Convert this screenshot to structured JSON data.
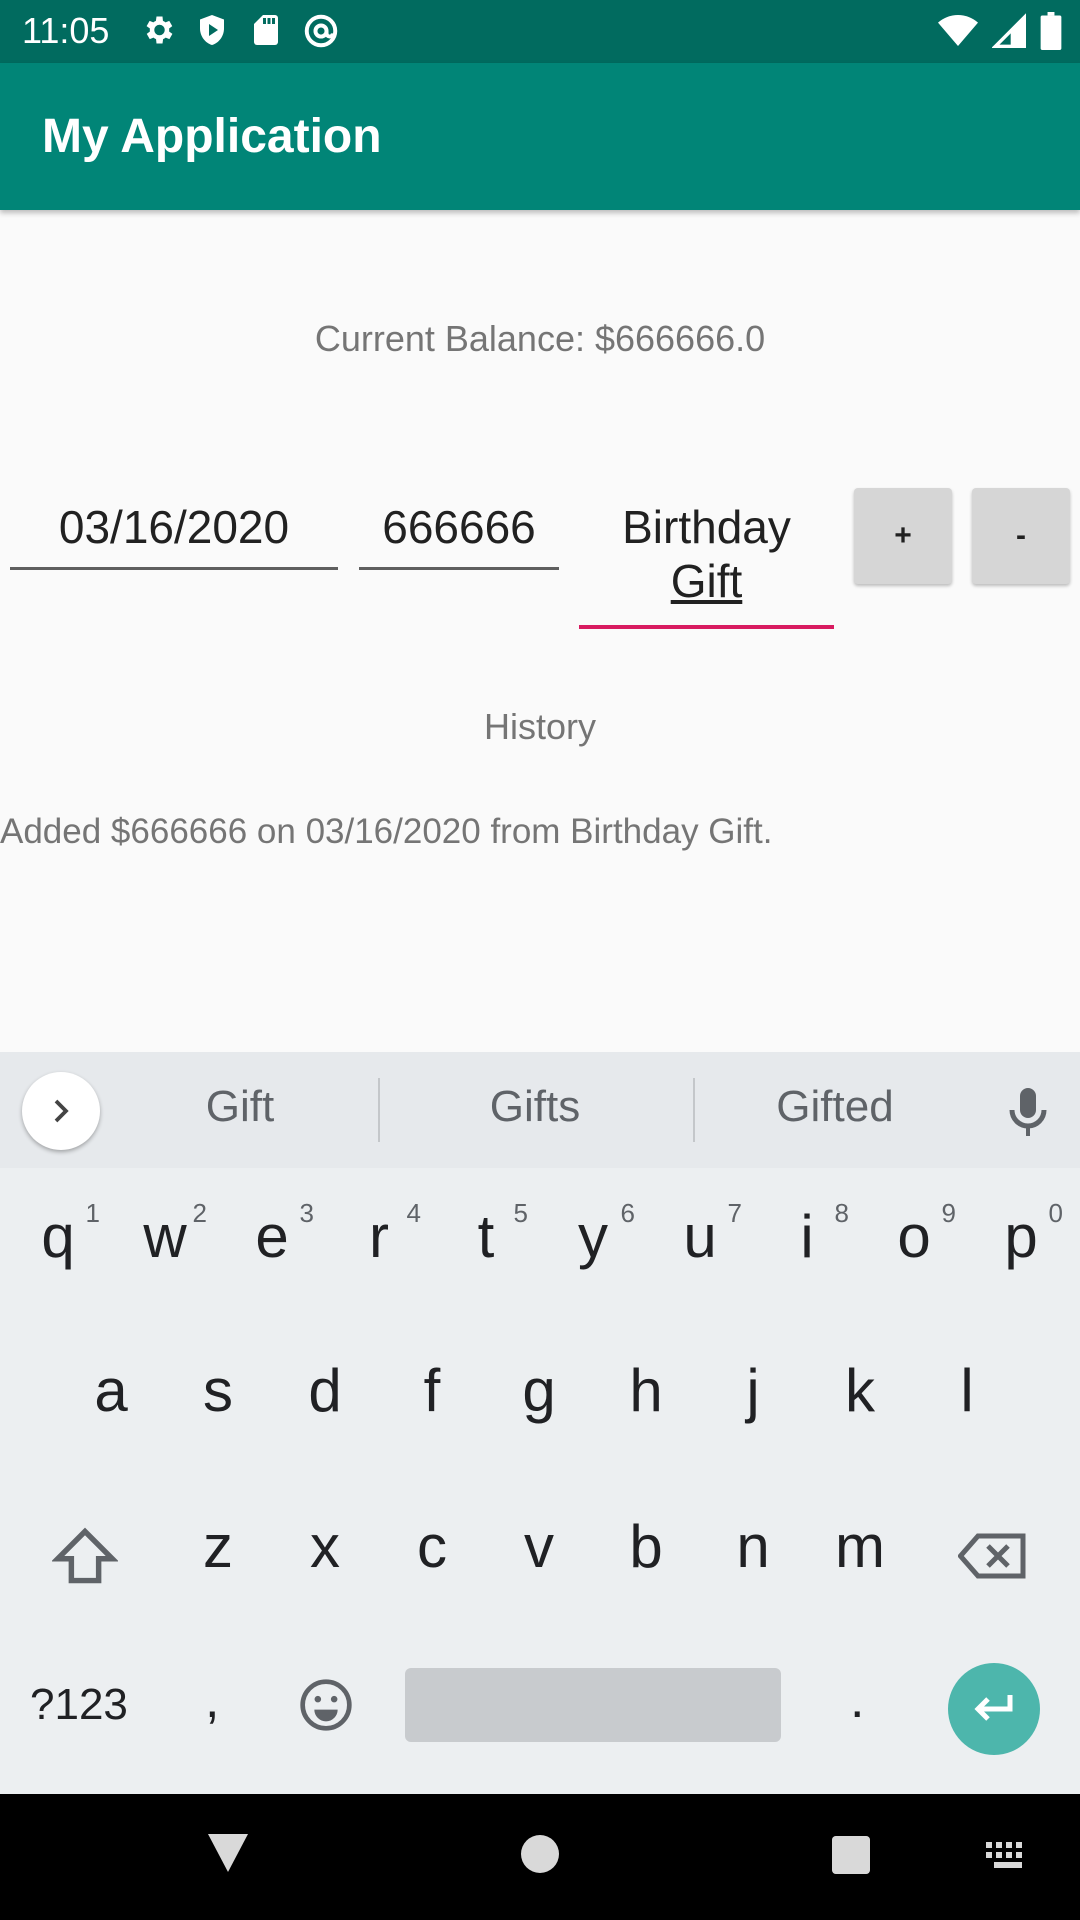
{
  "status_bar": {
    "time": "11:05",
    "icons": [
      "settings-icon",
      "shield-icon",
      "sd-card-icon",
      "at-sign-icon",
      "wifi-icon",
      "signal-icon",
      "battery-icon"
    ]
  },
  "app_bar": {
    "title": "My Application"
  },
  "balance": {
    "text": "Current Balance: $666666.0"
  },
  "form": {
    "date_value": "03/16/2020",
    "amount_value": "666666",
    "source_line1": "Birthday",
    "source_line2": "Gift",
    "add_label": "+",
    "subtract_label": "-"
  },
  "history": {
    "title": "History",
    "entries": [
      "Added $666666 on 03/16/2020 from Birthday Gift."
    ]
  },
  "keyboard": {
    "suggestions": [
      "Gift",
      "Gifts",
      "Gifted"
    ],
    "row1": [
      {
        "key": "q",
        "num": "1"
      },
      {
        "key": "w",
        "num": "2"
      },
      {
        "key": "e",
        "num": "3"
      },
      {
        "key": "r",
        "num": "4"
      },
      {
        "key": "t",
        "num": "5"
      },
      {
        "key": "y",
        "num": "6"
      },
      {
        "key": "u",
        "num": "7"
      },
      {
        "key": "i",
        "num": "8"
      },
      {
        "key": "o",
        "num": "9"
      },
      {
        "key": "p",
        "num": "0"
      }
    ],
    "row2": [
      "a",
      "s",
      "d",
      "f",
      "g",
      "h",
      "j",
      "k",
      "l"
    ],
    "row3": [
      "z",
      "x",
      "c",
      "v",
      "b",
      "n",
      "m"
    ],
    "symbols_label": "?123",
    "comma": ",",
    "period": "."
  },
  "colors": {
    "status_bar": "#016b5f",
    "app_bar": "#018577",
    "accent": "#d81b60",
    "enter_key": "#4db6ac"
  }
}
